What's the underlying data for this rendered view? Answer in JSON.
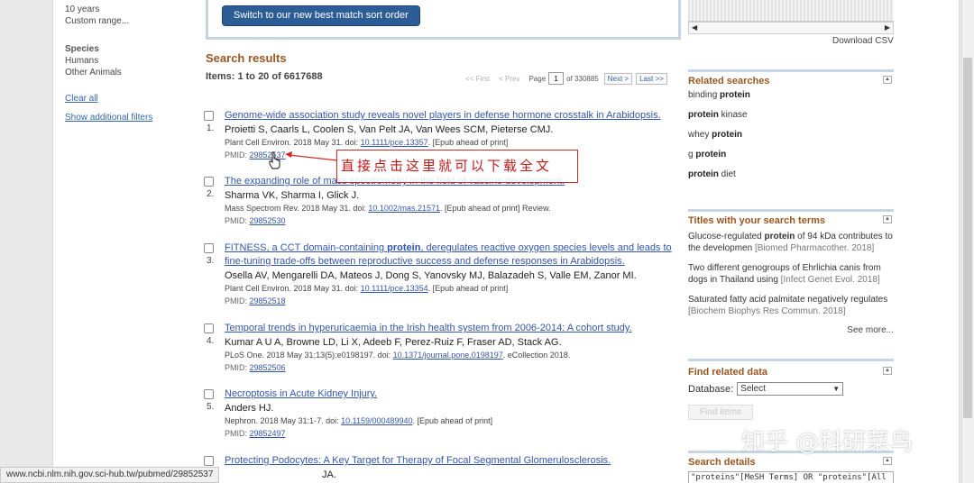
{
  "filters": {
    "dates": [
      "10 years",
      "Custom range..."
    ],
    "species_heading": "Species",
    "species": [
      "Humans",
      "Other Animals"
    ],
    "clear_all": "Clear all",
    "show_additional": "Show additional filters"
  },
  "top": {
    "sort_button": "Switch to our new best match sort order"
  },
  "results_header": {
    "title": "Search results",
    "count": "Items: 1 to 20 of 6617688"
  },
  "pager": {
    "first": "<< First",
    "prev": "< Prev",
    "page_label": "Page",
    "page_value": "1",
    "of": "of 330885",
    "next": "Next >",
    "last": "Last >>"
  },
  "results": [
    {
      "num": "1.",
      "title": "Genome-wide association study reveals novel players in defense hormone crosstalk in Arabidopsis.",
      "authors": "Proietti S, Caarls L, Coolen S, Van Pelt JA, Van Wees SCM, Pieterse CMJ.",
      "cite_pre": "Plant Cell Environ. 2018 May 31. doi: ",
      "doi": "10.1111/pce.13357",
      "cite_post": ". [Epub ahead of print]",
      "pmid_label": "PMID: ",
      "pmid": "29852537"
    },
    {
      "num": "2.",
      "title": "The expanding role of mass spectrometry in the field of vaccine development.",
      "authors": "Sharma VK, Sharma I, Glick J.",
      "cite_pre": "Mass Spectrom Rev. 2018 May 31. doi: ",
      "doi": "10.1002/mas.21571",
      "cite_post": ". [Epub ahead of print] Review.",
      "pmid_label": "PMID: ",
      "pmid": "29852530"
    },
    {
      "num": "3.",
      "title_a": "FITNESS, a CCT domain-containing ",
      "title_b": "protein",
      "title_c": ", deregulates reactive oxygen species levels and leads to fine-tuning trade-offs between reproductive success and defense responses in Arabidopsis.",
      "authors": "Osella AV, Mengarelli DA, Mateos J, Dong S, Yanovsky MJ, Balazadeh S, Valle EM, Zanor MI.",
      "cite_pre": "Plant Cell Environ. 2018 May 31. doi: ",
      "doi": "10.1111/pce.13354",
      "cite_post": ". [Epub ahead of print]",
      "pmid_label": "PMID: ",
      "pmid": "29852518"
    },
    {
      "num": "4.",
      "title": "Temporal trends in hyperuricaemia in the Irish health system from 2006-2014: A cohort study.",
      "authors": "Kumar A U A, Browne LD, Li X, Adeeb F, Perez-Ruiz F, Fraser AD, Stack AG.",
      "cite_pre": "PLoS One. 2018 May 31;13(5):e0198197. doi: ",
      "doi": "10.1371/journal.pone.0198197",
      "cite_post": ". eCollection 2018.",
      "pmid_label": "PMID: ",
      "pmid": "29852506"
    },
    {
      "num": "5.",
      "title": "Necroptosis in Acute Kidney Injury.",
      "authors": "Anders HJ.",
      "cite_pre": "Nephron. 2018 May 31:1-7. doi: ",
      "doi": "10.1159/000489940",
      "cite_post": ". [Epub ahead of print]",
      "pmid_label": "PMID: ",
      "pmid": "29852497"
    },
    {
      "title": "Protecting Podocytes: A Key Target for Therapy of Focal Segmental Glomerulosclerosis.",
      "authors_tail": "JA."
    }
  ],
  "annotation": "直接点击这里就可以下载全文",
  "right": {
    "download_csv": "Download CSV",
    "related_title": "Related searches",
    "related": [
      {
        "bold": "",
        "pre": "binding ",
        "b": "protein",
        "post": ""
      },
      {
        "pre": "",
        "b": "protein",
        "post": " kinase"
      },
      {
        "pre": "whey ",
        "b": "protein",
        "post": ""
      },
      {
        "pre": "g ",
        "b": "protein",
        "post": ""
      },
      {
        "pre": "",
        "b": "protein",
        "post": " diet"
      }
    ],
    "titles_title": "Titles with your search terms",
    "titles": [
      {
        "pre": "Glucose-regulated ",
        "b": "protein",
        "post": " of 94 kDa contributes to the developmen",
        "src": " [Biomed Pharmacother. 2018]"
      },
      {
        "pre": "Two different genogroups of Ehrlichia canis from dogs in Thailand using",
        "b": "",
        "post": "",
        "src": " [Infect Genet Evol. 2018]"
      },
      {
        "pre": "Saturated fatty acid palmitate negatively regulates",
        "b": "",
        "post": "",
        "src": " [Biochem Biophys Res Commun. 2018]"
      }
    ],
    "see_more": "See more...",
    "find_title": "Find related data",
    "database_label": "Database:",
    "database_value": "Select",
    "find_items": "Find items",
    "search_details_title": "Search details",
    "search_details": "\"proteins\"[MeSH Terms] OR \"proteins\"[All"
  },
  "status_url": "www.ncbi.nlm.nih.gov.sci-hub.tw/pubmed/29852537",
  "watermark": "知乎 @科研菜鸟"
}
